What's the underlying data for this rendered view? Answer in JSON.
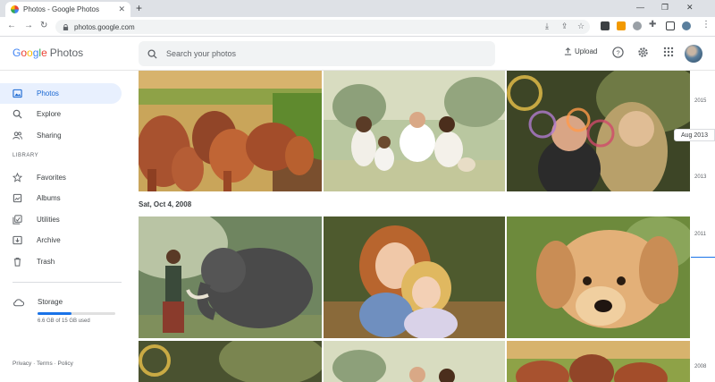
{
  "browser": {
    "tab_title": "Photos - Google Photos",
    "url": "photos.google.com",
    "icons": [
      "back-icon",
      "forward-icon",
      "reload-icon",
      "lock-icon",
      "download-icon",
      "share-icon",
      "star-icon",
      "extension-icon",
      "profile-icon",
      "menu-icon"
    ]
  },
  "header": {
    "logo": {
      "g": "G",
      "o1": "o",
      "o2": "o",
      "g2": "g",
      "l": "l",
      "e": "e",
      "photos": "Photos"
    },
    "search_placeholder": "Search your photos",
    "upload_label": "Upload"
  },
  "sidebar": {
    "items": [
      {
        "label": "Photos",
        "icon": "photo-icon",
        "active": true
      },
      {
        "label": "Explore",
        "icon": "search-icon",
        "active": false
      },
      {
        "label": "Sharing",
        "icon": "people-icon",
        "active": false
      }
    ],
    "library_label": "LIBRARY",
    "library_items": [
      {
        "label": "Favorites",
        "icon": "star-icon"
      },
      {
        "label": "Albums",
        "icon": "album-icon"
      },
      {
        "label": "Utilities",
        "icon": "utilities-icon"
      },
      {
        "label": "Archive",
        "icon": "archive-icon"
      },
      {
        "label": "Trash",
        "icon": "trash-icon"
      }
    ],
    "storage": {
      "label": "Storage",
      "used_text": "6.6 GB of 15 GB used",
      "used_fraction": 0.44
    },
    "footer": {
      "privacy": "Privacy",
      "sep1": "·",
      "terms": "Terms",
      "sep2": "·",
      "policy": "Policy"
    }
  },
  "main": {
    "date_label": "Sat, Oct 4, 2008",
    "photos": [
      "elephants",
      "family-on-grass",
      "boy-and-woman-bubbles",
      "woman-with-elephant",
      "hugging-girls",
      "puppy",
      "bubbles-partial",
      "family-partial",
      "elephants-partial"
    ]
  },
  "scrubber": {
    "years": [
      "2015",
      "2013",
      "2011",
      "2008"
    ],
    "current": "Aug 2013"
  },
  "colors": {
    "accent": "#1a73e8",
    "active_bg": "#e8f0fe"
  }
}
